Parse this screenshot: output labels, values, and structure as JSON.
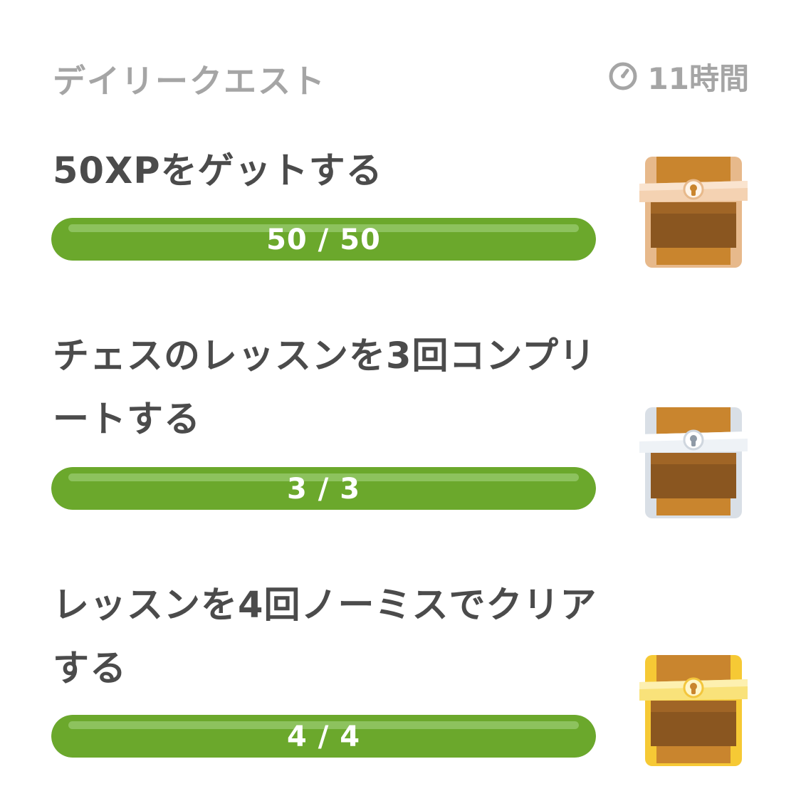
{
  "header": {
    "title": "デイリークエスト",
    "timer_icon": "timer-icon",
    "timer_label": "11時間"
  },
  "quests": [
    {
      "title": "50XPをゲットする",
      "progress_label": "50 / 50",
      "progress": 1.0,
      "chest_icon": "bronze-chest-icon",
      "chest_trim": "#f0c9a0"
    },
    {
      "title": "チェスのレッスンを3回コンプリートする",
      "progress_label": "3 / 3",
      "progress": 1.0,
      "chest_icon": "silver-chest-icon",
      "chest_trim": "#dde3ea"
    },
    {
      "title": "レッスンを4回ノーミスでクリアする",
      "progress_label": "4 / 4",
      "progress": 1.0,
      "chest_icon": "gold-chest-icon",
      "chest_trim": "#f8dd63"
    }
  ],
  "colors": {
    "progress_fill": "#6ba82c",
    "progress_shine": "#8dc25e",
    "header_text": "#a5a5a5",
    "quest_text": "#4b4b4b"
  }
}
